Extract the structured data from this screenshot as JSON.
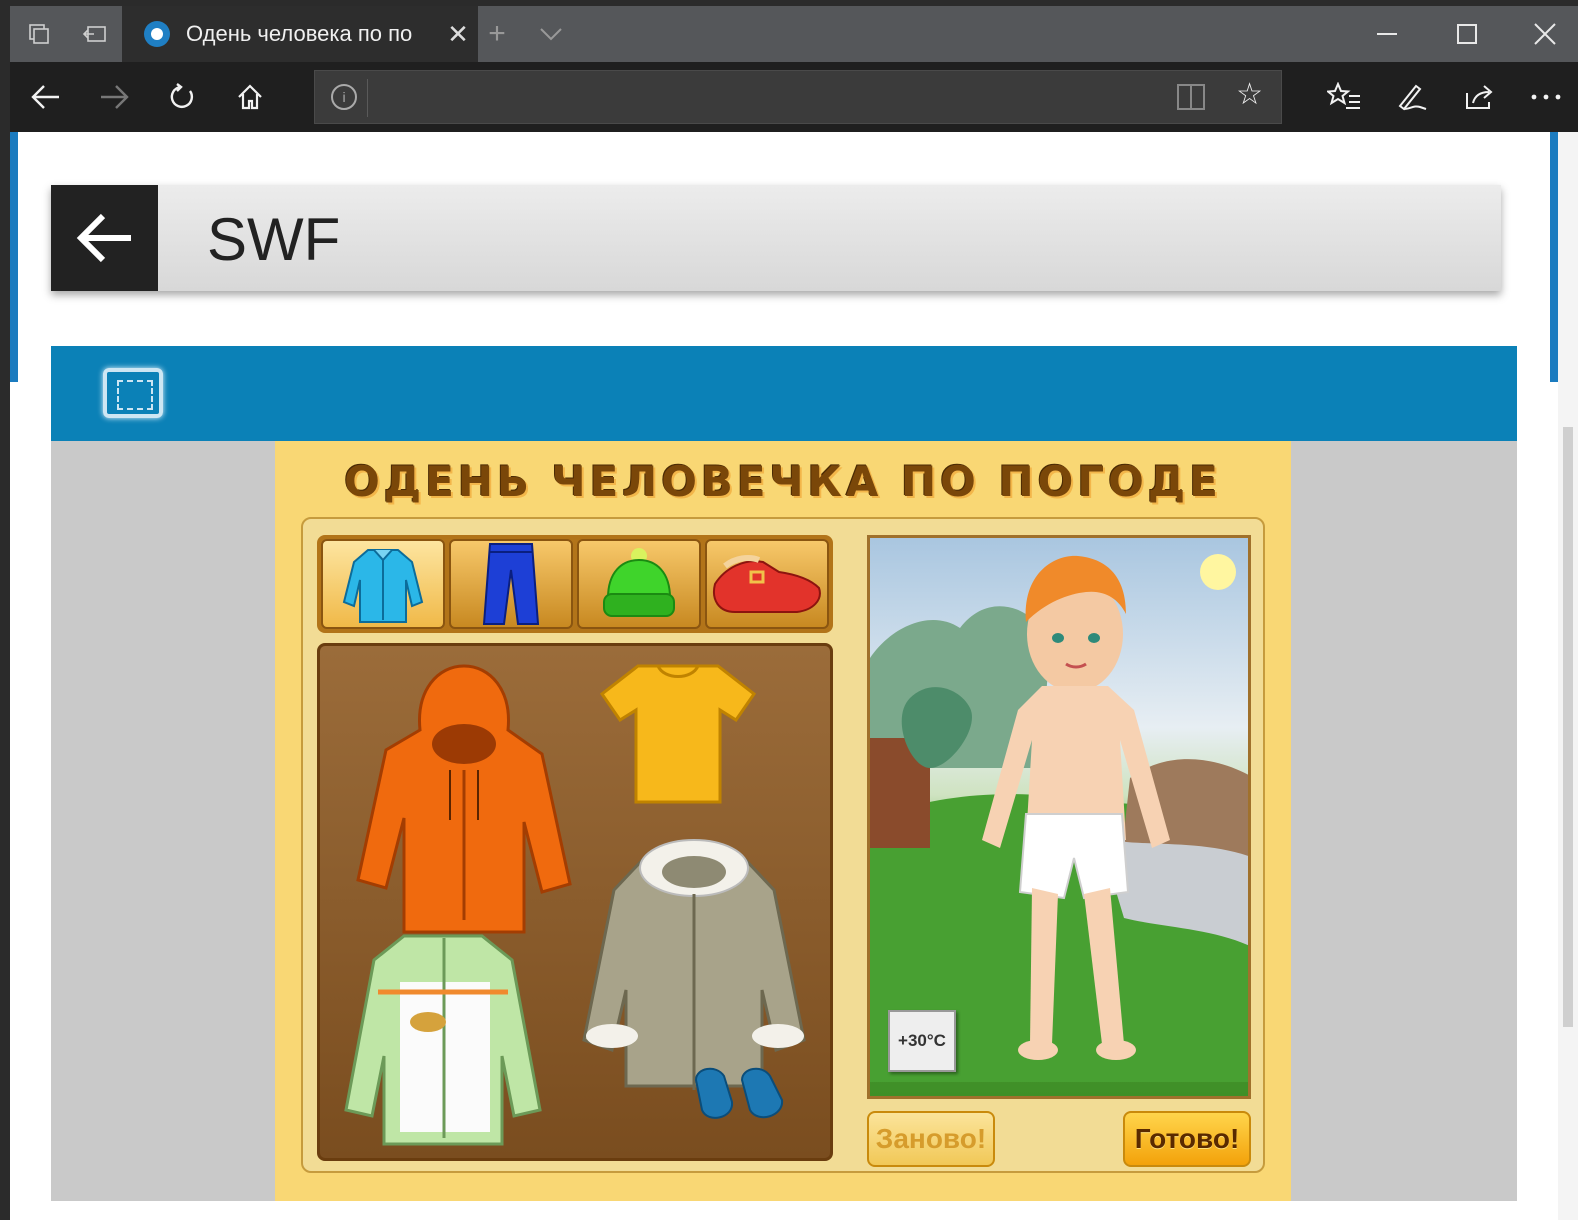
{
  "browser": {
    "tab_title": "Одень человека по по",
    "new_tab_label": "+",
    "close_tab_label": "✕"
  },
  "page": {
    "header_title": "SWF"
  },
  "game": {
    "title": "ОДЕНЬ ЧЕЛОВЕЧКА ПО ПОГОДЕ",
    "temperature": "+30°C",
    "reset_button": "Заново!",
    "done_button": "Готово!",
    "categories": [
      "jacket",
      "pants",
      "hat",
      "shoes"
    ],
    "active_category": "jacket",
    "wardrobe_items": [
      "orange-hoodie",
      "yellow-tshirt",
      "light-green-jacket",
      "grey-fur-coat",
      "blue-mittens"
    ]
  },
  "colors": {
    "accent_blue": "#0b81b7",
    "game_background": "#f9d774",
    "title_brown": "#7a4709"
  }
}
